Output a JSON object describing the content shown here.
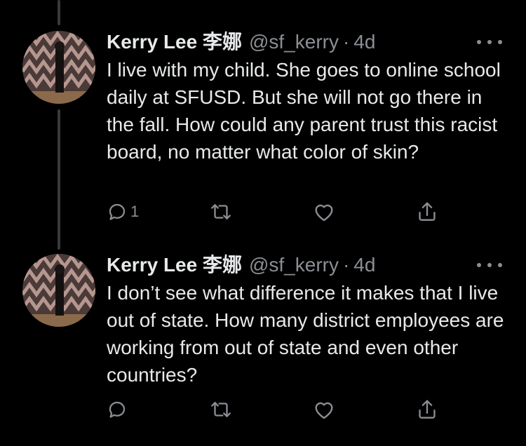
{
  "tweets": [
    {
      "author_name": "Kerry Lee 李娜",
      "handle": "@sf_kerry",
      "separator": "·",
      "time": "4d",
      "text": "I live with my child. She goes to online school daily at SFUSD. But she will not go there in the fall. How could any parent trust this racist board, no matter what color of skin?",
      "reply_count": "1",
      "retweet_count": "",
      "like_count": ""
    },
    {
      "author_name": "Kerry Lee 李娜",
      "handle": "@sf_kerry",
      "separator": "·",
      "time": "4d",
      "text": "I don’t see what difference it makes that I live out of state. How many district employees are working from out of state and even other countries?",
      "reply_count": "",
      "retweet_count": "",
      "like_count": ""
    }
  ],
  "icons": {
    "reply": "reply-icon",
    "retweet": "retweet-icon",
    "like": "heart-icon",
    "share": "share-icon",
    "more": "more-options-icon"
  },
  "colors": {
    "background": "#000000",
    "primary_text": "#e7e9ea",
    "secondary_text": "#8b8f94",
    "thread_line": "#3a3a3a"
  }
}
